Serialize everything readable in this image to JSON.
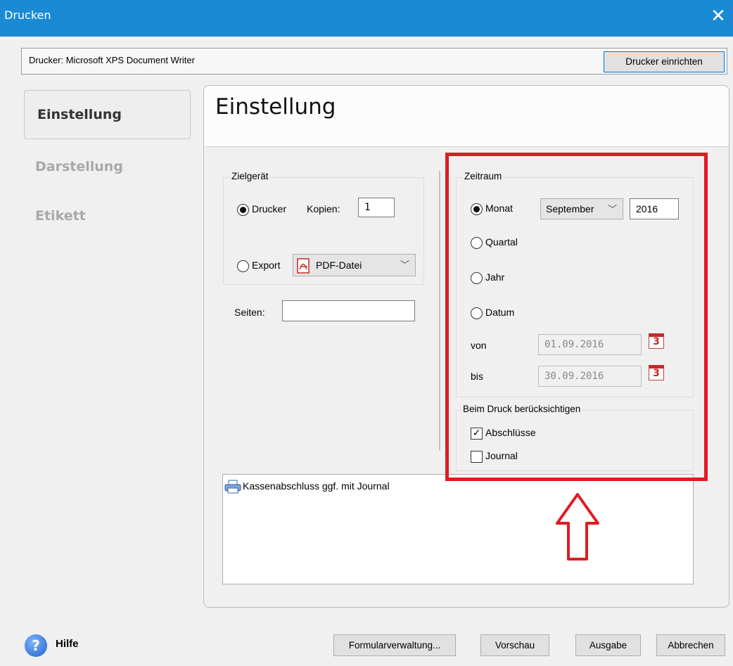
{
  "window": {
    "title": "Drucken",
    "close_icon": "✕"
  },
  "printer": {
    "label": "Drucker: Microsoft XPS Document Writer",
    "setup_button": "Drucker einrichten"
  },
  "nav": {
    "items": [
      "Einstellung",
      "Darstellung",
      "Etikett"
    ],
    "active": "Einstellung"
  },
  "panel": {
    "title": "Einstellung"
  },
  "zielgeraet": {
    "legend": "Zielgerät",
    "drucker_label": "Drucker",
    "kopien_label": "Kopien:",
    "kopien_value": "1",
    "export_label": "Export",
    "export_format": "PDF-Datei",
    "selected": "Drucker"
  },
  "seiten": {
    "label": "Seiten:",
    "value": ""
  },
  "zeitraum": {
    "legend": "Zeitraum",
    "options": [
      "Monat",
      "Quartal",
      "Jahr",
      "Datum"
    ],
    "selected": "Monat",
    "month": "September",
    "year": "2016",
    "von_label": "von",
    "von_value": "01.09.2016",
    "bis_label": "bis",
    "bis_value": "30.09.2016",
    "calendar_icon_text": "3"
  },
  "beim_druck": {
    "legend": "Beim Druck berücksichtigen",
    "abschluesse_label": "Abschlüsse",
    "abschluesse_checked": true,
    "journal_label": "Journal",
    "journal_checked": false
  },
  "forms": {
    "items": [
      "Kassenabschluss ggf. mit Journal"
    ]
  },
  "footer": {
    "help_label": "Hilfe",
    "help_icon_text": "?",
    "buttons": [
      "Formularverwaltung...",
      "Vorschau",
      "Ausgabe",
      "Abbrechen"
    ]
  },
  "colors": {
    "titlebar": "#1a8ad4",
    "highlight": "#e01b22",
    "calendar": "#c62828"
  }
}
